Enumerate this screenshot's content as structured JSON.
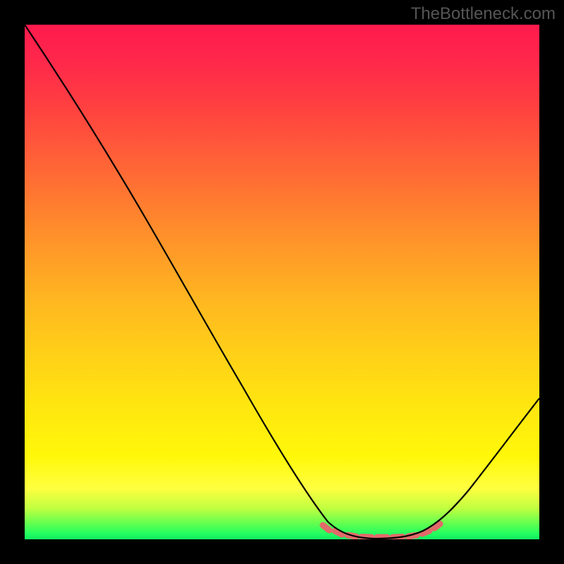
{
  "watermark": "TheBottleneck.com",
  "chart_data": {
    "type": "line",
    "title": "",
    "xlabel": "",
    "ylabel": "",
    "x": [
      0.0,
      0.05,
      0.1,
      0.15,
      0.2,
      0.25,
      0.3,
      0.35,
      0.4,
      0.45,
      0.5,
      0.55,
      0.6,
      0.62,
      0.64,
      0.66,
      0.68,
      0.7,
      0.72,
      0.74,
      0.76,
      0.78,
      0.8,
      0.85,
      0.9,
      0.95,
      1.0
    ],
    "values": [
      100.0,
      91.5,
      83.0,
      74.5,
      66.0,
      57.5,
      49.0,
      40.5,
      32.0,
      23.5,
      15.0,
      8.0,
      2.5,
      1.2,
      0.5,
      0.2,
      0.1,
      0.1,
      0.2,
      0.5,
      1.2,
      2.5,
      5.0,
      12.0,
      20.0,
      28.0,
      36.0
    ],
    "xlim": [
      0,
      1
    ],
    "ylim": [
      0,
      100
    ],
    "salmon_marker_range_x": [
      0.58,
      0.8
    ],
    "gradient": {
      "top": "#ff1a4d",
      "mid1": "#ff9a28",
      "mid2": "#fff80a",
      "bottom": "#20ff60"
    }
  }
}
